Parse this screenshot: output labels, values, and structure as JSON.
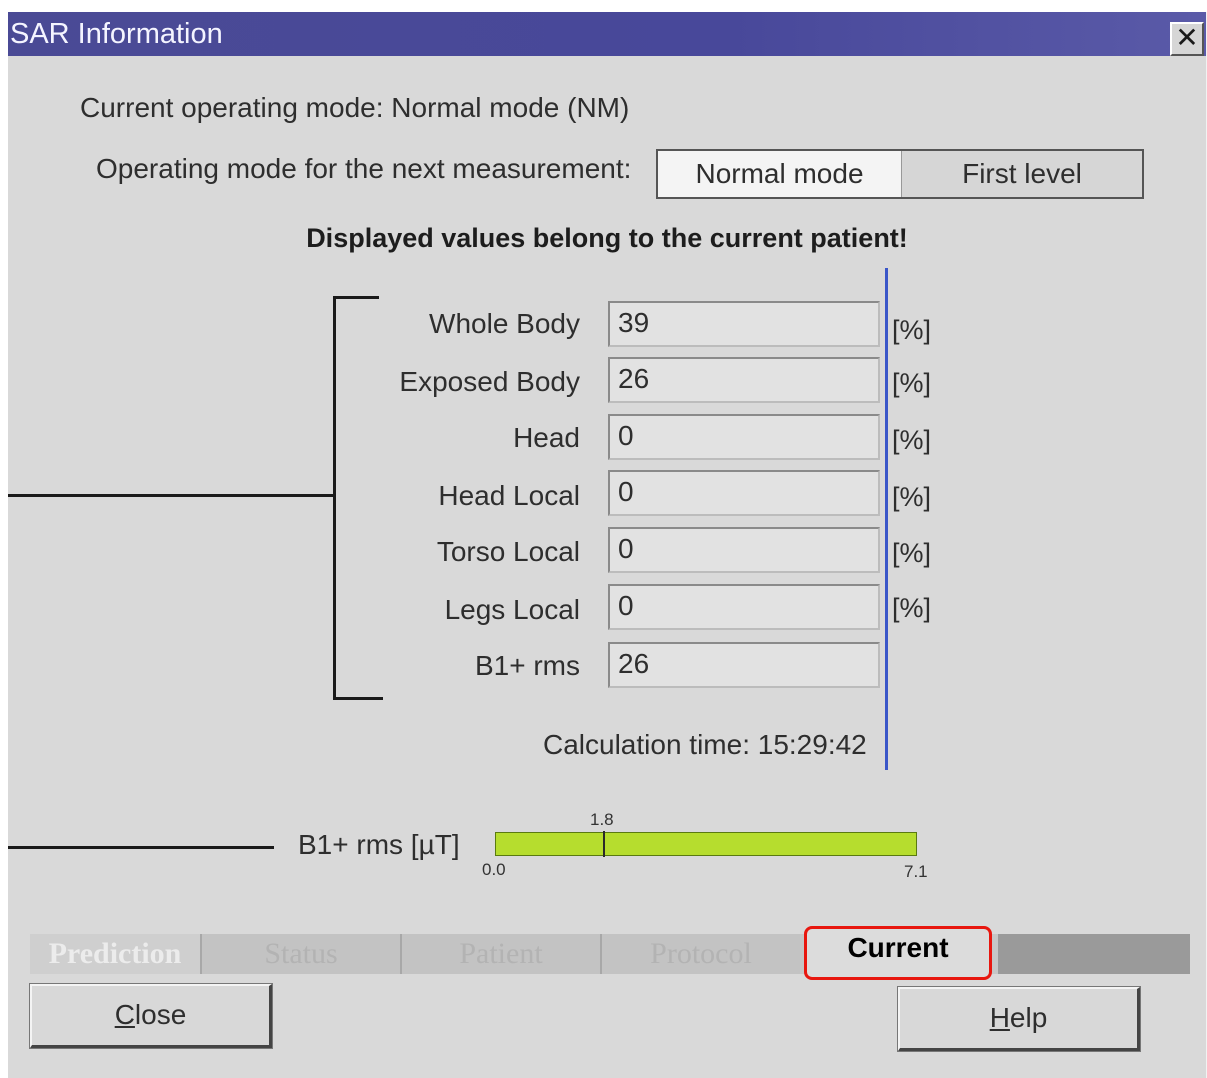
{
  "window": {
    "title": "SAR Information",
    "close_glyph": "✕",
    "close_icon": "close-icon"
  },
  "mode": {
    "current_label": "Current operating mode: Normal mode (NM)",
    "next_label": "Operating mode for the next measurement:",
    "options": [
      "Normal mode",
      "First level"
    ],
    "selected": "Normal mode"
  },
  "notice": "Displayed values belong to the current patient!",
  "sar": {
    "rows": [
      {
        "label": "Whole Body",
        "value": "39",
        "unit": "[%]"
      },
      {
        "label": "Exposed Body",
        "value": "26",
        "unit": "[%]"
      },
      {
        "label": "Head",
        "value": "0",
        "unit": "[%]"
      },
      {
        "label": "Head Local",
        "value": "0",
        "unit": "[%]"
      },
      {
        "label": "Torso Local",
        "value": "0",
        "unit": "[%]"
      },
      {
        "label": "Legs Local",
        "value": "0",
        "unit": "[%]"
      },
      {
        "label": "B1+ rms",
        "value": "26",
        "unit": ""
      }
    ],
    "calc_time": "Calculation time: 15:29:42"
  },
  "b1_gauge": {
    "label": "B1+ rms [µT]",
    "min": 0.0,
    "max": 7.1,
    "marker": 1.8,
    "min_text": "0.0",
    "max_text": "7.1",
    "marker_text": "1.8",
    "fill_color": "#b6dd2e"
  },
  "tabs": [
    "Prediction",
    "Status",
    "Patient",
    "Protocol",
    "Current"
  ],
  "active_tab": "Current",
  "highlight_color": "#e8170f",
  "buttons": {
    "close_rest": "lose",
    "close_mnemonic": "C",
    "help_rest": "elp",
    "help_mnemonic": "H"
  }
}
